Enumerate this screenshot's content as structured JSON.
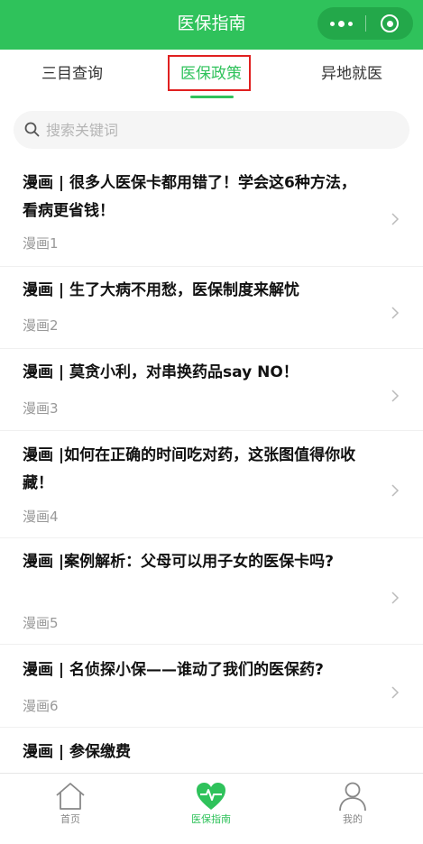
{
  "header": {
    "title": "医保指南"
  },
  "tabs": [
    {
      "label": "三目查询"
    },
    {
      "label": "医保政策",
      "active": true
    },
    {
      "label": "异地就医"
    }
  ],
  "search": {
    "placeholder": "搜索关键词",
    "value": ""
  },
  "articles": [
    {
      "title": "漫画 | 很多人医保卡都用错了！学会这6种方法，看病更省钱！",
      "subtitle": "漫画1"
    },
    {
      "title": "漫画 | 生了大病不用愁，医保制度来解忧",
      "subtitle": "漫画2"
    },
    {
      "title": "漫画 | 莫贪小利，对串换药品say NO！",
      "subtitle": "漫画3"
    },
    {
      "title": "漫画 |如何在正确的时间吃对药，这张图值得你收藏！",
      "subtitle": "漫画4"
    },
    {
      "title": "漫画 |案例解析：父母可以用子女的医保卡吗?",
      "subtitle": "漫画5"
    },
    {
      "title": "漫画 | 名侦探小保——谁动了我们的医保药?",
      "subtitle": "漫画6"
    },
    {
      "title": "漫画 | 参保缴费",
      "subtitle": ""
    }
  ],
  "bottom_nav": [
    {
      "label": "首页",
      "icon": "home-icon"
    },
    {
      "label": "医保指南",
      "icon": "heart-pulse-icon",
      "active": true
    },
    {
      "label": "我的",
      "icon": "user-icon"
    }
  ],
  "colors": {
    "brand_green": "#2fc25b",
    "highlight_red": "#e02020"
  }
}
